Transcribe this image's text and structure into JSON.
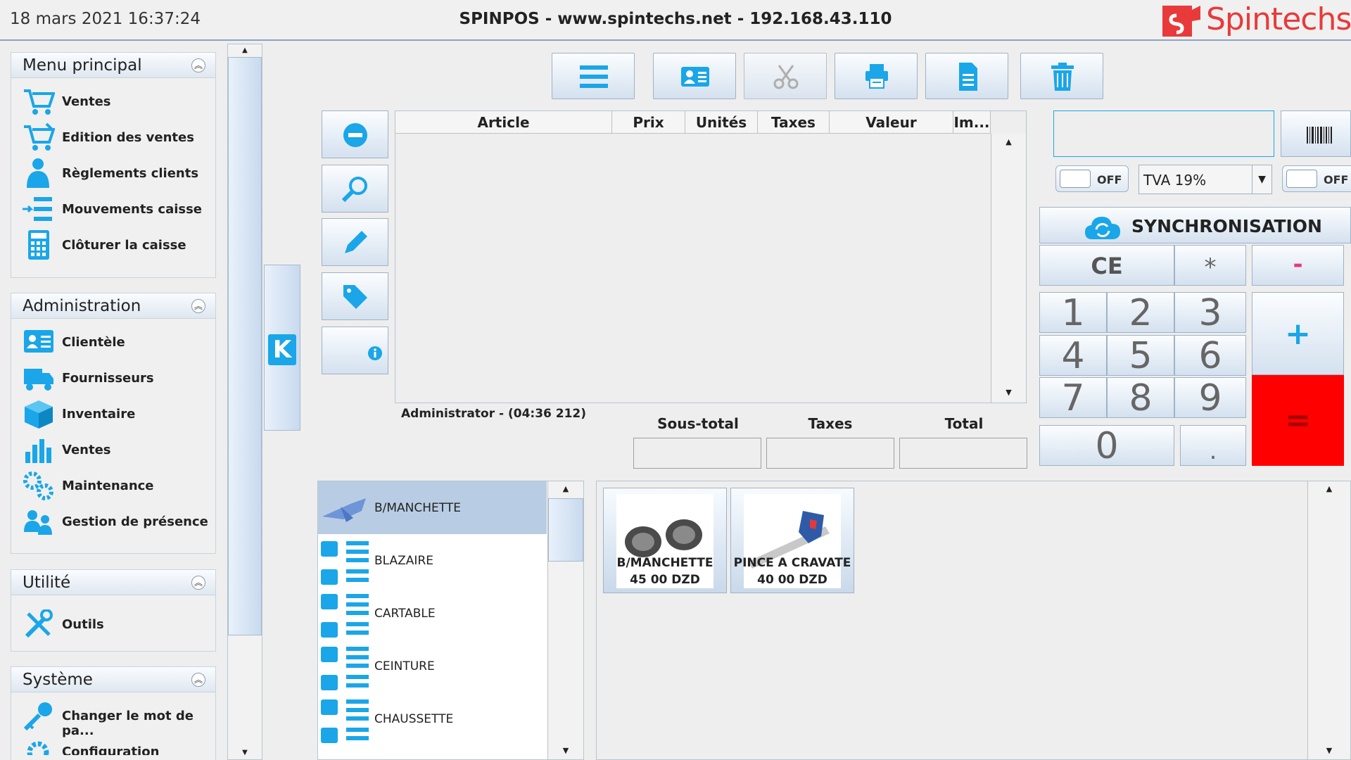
{
  "header": {
    "datetime": "18 mars 2021 16:37:24",
    "title": "SPINPOS - www.spintechs.net - 192.168.43.110",
    "logo_text": "Spintechs"
  },
  "sidebar": {
    "sections": [
      {
        "title": "Menu principal",
        "items": [
          "Ventes",
          "Edition des ventes",
          "Règlements clients",
          "Mouvements caisse",
          "Clôturer la caisse"
        ]
      },
      {
        "title": "Administration",
        "items": [
          "Clientèle",
          "Fournisseurs",
          "Inventaire",
          "Ventes",
          "Maintenance",
          "Gestion de présence"
        ]
      },
      {
        "title": "Utilité",
        "items": [
          "Outils"
        ]
      },
      {
        "title": "Système",
        "items": [
          "Changer le mot de pa...",
          "Configuration"
        ]
      }
    ]
  },
  "table": {
    "columns": [
      "Article",
      "Prix",
      "Unités",
      "Taxes",
      "Valeur",
      "Im..."
    ]
  },
  "status": {
    "user": "Administrator - (04:36 212)"
  },
  "totals": {
    "labels": [
      "Sous-total",
      "Taxes",
      "Total"
    ]
  },
  "right": {
    "toggle_off": "OFF",
    "tva": "TVA 19%",
    "sync": "SYNCHRONISATION"
  },
  "keypad": {
    "ce": "CE",
    "star": "*",
    "minus": "-",
    "plus": "+",
    "equals": "=",
    "dot": ".",
    "digits": [
      "1",
      "2",
      "3",
      "4",
      "5",
      "6",
      "7",
      "8",
      "9",
      "0"
    ]
  },
  "categories": [
    "B/MANCHETTE",
    "BLAZAIRE",
    "CARTABLE",
    "CEINTURE",
    "CHAUSSETTE"
  ],
  "products": [
    {
      "name": "B/MANCHETTE",
      "price": "45 00 DZD"
    },
    {
      "name": "PINCE A CRAVATE",
      "price": "40 00 DZD"
    }
  ],
  "colors": {
    "accent": "#1aa6e8",
    "logo": "#e83a3a",
    "equals_bg": "#ff0000",
    "selected_row": "#b8cde4"
  }
}
